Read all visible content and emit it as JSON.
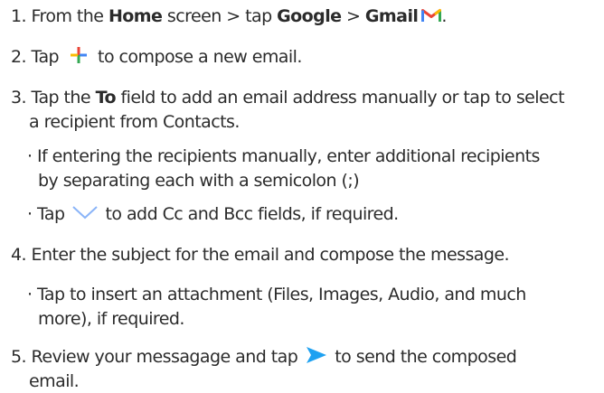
{
  "steps": {
    "s1": {
      "num": "1.",
      "pre": "From the",
      "home": "Home",
      "mid1": "screen > tap",
      "google": "Google",
      "gt": ">",
      "gmail": "Gmail",
      "end": "."
    },
    "s2": {
      "num": "2.",
      "pre": "Tap",
      "post": "to compose a new email."
    },
    "s3": {
      "num": "3.",
      "pre": "Tap the",
      "to": "To",
      "post": "field to add an email address manually or tap to select",
      "line2": "a recipient from Contacts.",
      "b1_line1": "· If entering the recipients manually, enter additional recipients",
      "b1_line2": "by separating each with a semicolon (;)",
      "b2_pre": "· Tap",
      "b2_post": "to add Cc and Bcc fields, if required."
    },
    "s4": {
      "num": "4.",
      "text": "Enter the subject for the email and compose the message.",
      "b1_line1": "· Tap to insert an attachment (Files, Images, Audio, and much",
      "b1_line2": "more), if required."
    },
    "s5": {
      "num": "5.",
      "pre": "Review your messagage and tap",
      "post": "to send the composed",
      "line2": "email."
    }
  },
  "icons": {
    "gmail": "gmail-logo-icon",
    "compose": "compose-plus-icon",
    "expand": "chevron-down-icon",
    "send": "send-arrow-icon"
  },
  "colors": {
    "text": "#2b2b2b",
    "gmail_red": "#ea4335",
    "gmail_yellow": "#fbbc04",
    "gmail_green": "#34a853",
    "gmail_blue": "#4285f4",
    "chevron": "#8ab4f8",
    "send": "#1ea1f1"
  }
}
